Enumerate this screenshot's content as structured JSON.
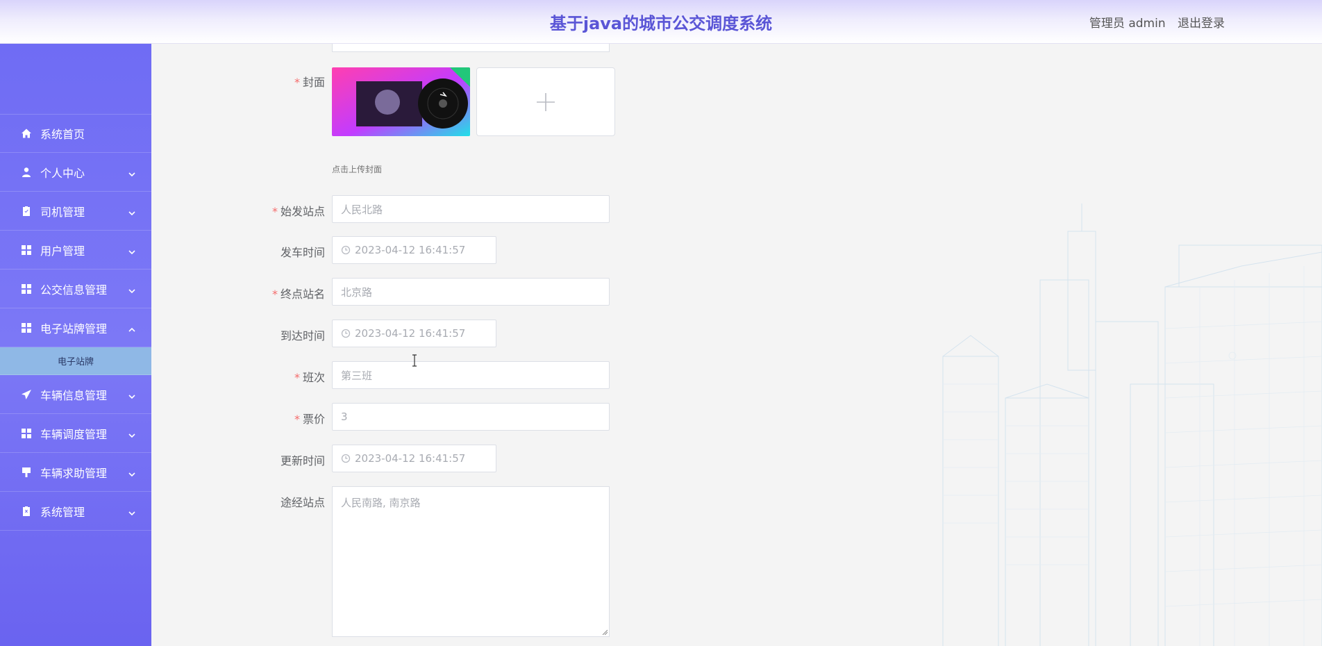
{
  "header": {
    "title": "基于java的城市公交调度系统",
    "user_role": "管理员 admin",
    "logout": "退出登录"
  },
  "sidebar": {
    "items": [
      {
        "label": "系统首页",
        "icon": "home-icon"
      },
      {
        "label": "个人中心",
        "icon": "user-icon"
      },
      {
        "label": "司机管理",
        "icon": "clipboard-icon"
      },
      {
        "label": "用户管理",
        "icon": "grid-icon"
      },
      {
        "label": "公交信息管理",
        "icon": "grid-icon"
      },
      {
        "label": "电子站牌管理",
        "icon": "grid-icon",
        "expanded": true
      },
      {
        "label": "车辆信息管理",
        "icon": "paper-plane-icon"
      },
      {
        "label": "车辆调度管理",
        "icon": "grid-icon"
      },
      {
        "label": "车辆求助管理",
        "icon": "brush-icon"
      },
      {
        "label": "系统管理",
        "icon": "clipboard-x-icon"
      }
    ],
    "submenu": {
      "label": "电子站牌"
    }
  },
  "form": {
    "cover": {
      "label": "封面",
      "hint": "点击上传封面"
    },
    "start_station": {
      "label": "始发站点",
      "value": "人民北路"
    },
    "depart_time": {
      "label": "发车时间",
      "value": "2023-04-12 16:41:57"
    },
    "end_station": {
      "label": "终点站名",
      "value": "北京路"
    },
    "arrive_time": {
      "label": "到达时间",
      "value": "2023-04-12 16:41:57"
    },
    "shift": {
      "label": "班次",
      "value": "第三班"
    },
    "fare": {
      "label": "票价",
      "value": "3"
    },
    "update_time": {
      "label": "更新时间",
      "value": "2023-04-12 16:41:57"
    },
    "via_stations": {
      "label": "途经站点",
      "value": "人民南路, 南京路"
    }
  },
  "colors": {
    "accent": "#5a55d6",
    "sidebar": "#7c78f6",
    "submenu": "#8fb8e6",
    "required": "#f56c6c"
  }
}
